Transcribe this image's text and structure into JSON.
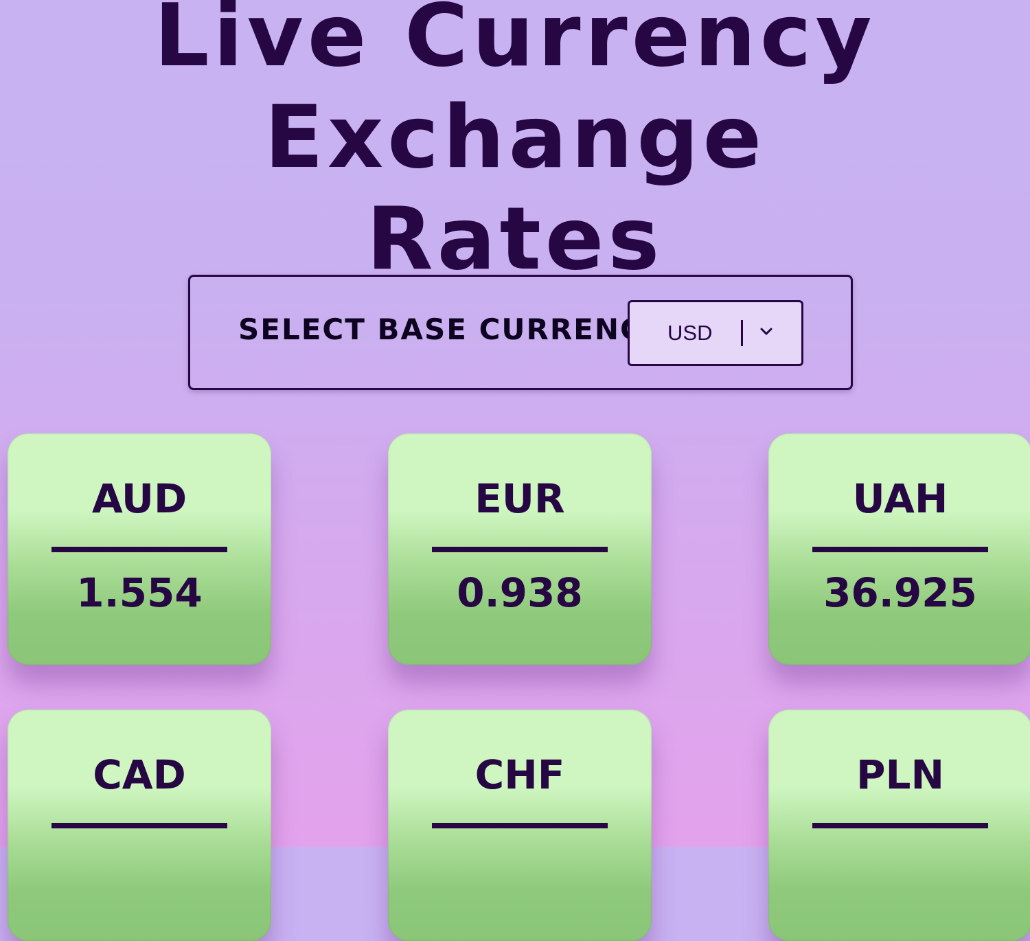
{
  "page": {
    "title_line1": "Live Currency Exchange",
    "title_line2": "Rates"
  },
  "selector": {
    "label": "SELECT BASE CURRENCY:",
    "value": "USD",
    "icon": "chevron-down-icon"
  },
  "rates": [
    {
      "code": "AUD",
      "rate": "1.554"
    },
    {
      "code": "EUR",
      "rate": "0.938"
    },
    {
      "code": "UAH",
      "rate": "36.925"
    },
    {
      "code": "CAD",
      "rate": ""
    },
    {
      "code": "CHF",
      "rate": ""
    },
    {
      "code": "PLN",
      "rate": ""
    }
  ],
  "colors": {
    "text": "#260643",
    "card_top": "#cff6c1",
    "card_bottom": "#8bc678",
    "background_top": "#c8b2f2",
    "background_bottom": "#e3a2ec"
  }
}
